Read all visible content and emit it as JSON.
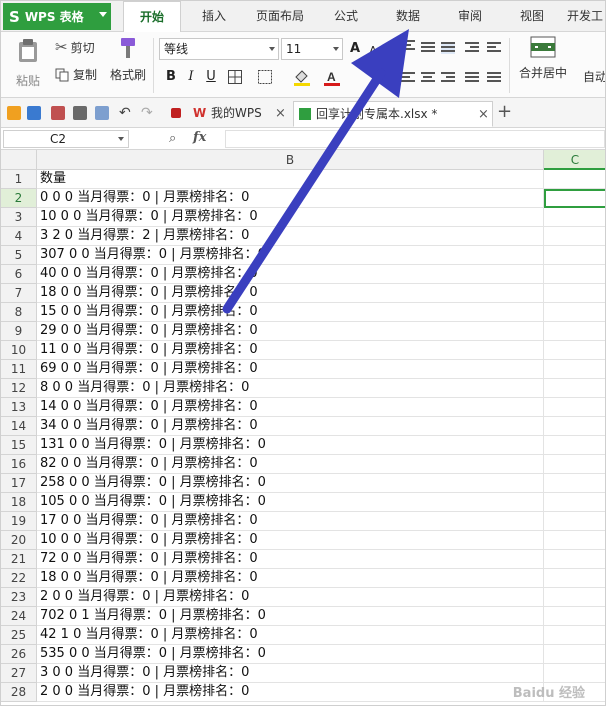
{
  "app": {
    "logo_text": "WPS 表格",
    "brand_color": "#2f9e3f"
  },
  "menu": {
    "tabs": [
      "开始",
      "插入",
      "页面布局",
      "公式",
      "数据",
      "审阅",
      "视图",
      "开发工"
    ],
    "active": "开始"
  },
  "ribbon": {
    "paste_label": "粘贴",
    "cut_label": "剪切",
    "copy_label": "复制",
    "format_painter_label": "格式刷",
    "font_name": "等线",
    "font_size": "11",
    "bold": "B",
    "italic": "I",
    "underline": "U",
    "merge_label": "合并居中",
    "wrap_label": "自动"
  },
  "docbar": {
    "tab_mywps": "我的WPS",
    "tab_file": "回享计划专属本.xlsx *",
    "add_tab": "+"
  },
  "formula": {
    "cell_ref": "C2",
    "fx": "fx",
    "value": ""
  },
  "grid": {
    "columns": [
      "B",
      "C"
    ],
    "selected_column": "C",
    "rows": [
      {
        "n": "1",
        "b": "数量"
      },
      {
        "n": "2",
        "b": "0 0 0 当月得票：0 | 月票榜排名：0"
      },
      {
        "n": "3",
        "b": "10 0 0 当月得票：0 | 月票榜排名：0"
      },
      {
        "n": "4",
        "b": "3 2 0 当月得票：2 | 月票榜排名：0"
      },
      {
        "n": "5",
        "b": "307 0 0 当月得票：0 | 月票榜排名：0"
      },
      {
        "n": "6",
        "b": "40 0 0 当月得票：0 | 月票榜排名：0"
      },
      {
        "n": "7",
        "b": "18 0 0 当月得票：0 | 月票榜排名：0"
      },
      {
        "n": "8",
        "b": "15 0 0 当月得票：0 | 月票榜排名：0"
      },
      {
        "n": "9",
        "b": "29 0 0 当月得票：0 | 月票榜排名：0"
      },
      {
        "n": "10",
        "b": "11 0 0 当月得票：0 | 月票榜排名：0"
      },
      {
        "n": "11",
        "b": "69 0 0 当月得票：0 | 月票榜排名：0"
      },
      {
        "n": "12",
        "b": "8 0 0 当月得票：0 | 月票榜排名：0"
      },
      {
        "n": "13",
        "b": "14 0 0 当月得票：0 | 月票榜排名：0"
      },
      {
        "n": "14",
        "b": "34 0 0 当月得票：0 | 月票榜排名：0"
      },
      {
        "n": "15",
        "b": "131 0 0 当月得票：0 | 月票榜排名：0"
      },
      {
        "n": "16",
        "b": "82 0 0 当月得票：0 | 月票榜排名：0"
      },
      {
        "n": "17",
        "b": "258 0 0 当月得票：0 | 月票榜排名：0"
      },
      {
        "n": "18",
        "b": "105 0 0 当月得票：0 | 月票榜排名：0"
      },
      {
        "n": "19",
        "b": "17 0 0 当月得票：0 | 月票榜排名：0"
      },
      {
        "n": "20",
        "b": "10 0 0 当月得票：0 | 月票榜排名：0"
      },
      {
        "n": "21",
        "b": "72 0 0 当月得票：0 | 月票榜排名：0"
      },
      {
        "n": "22",
        "b": "18 0 0 当月得票：0 | 月票榜排名：0"
      },
      {
        "n": "23",
        "b": "2 0 0 当月得票：0 | 月票榜排名：0"
      },
      {
        "n": "24",
        "b": "702 0 1 当月得票：0 | 月票榜排名：0"
      },
      {
        "n": "25",
        "b": "42 1 0 当月得票：0 | 月票榜排名：0"
      },
      {
        "n": "26",
        "b": "535 0 0 当月得票：0 | 月票榜排名：0"
      },
      {
        "n": "27",
        "b": "3 0 0 当月得票：0 | 月票榜排名：0"
      },
      {
        "n": "28",
        "b": "2 0 0 当月得票：0 | 月票榜排名：0"
      }
    ]
  },
  "annotation": {
    "arrow_color": "#3a3fbf"
  },
  "watermark": "Baidu 经验"
}
